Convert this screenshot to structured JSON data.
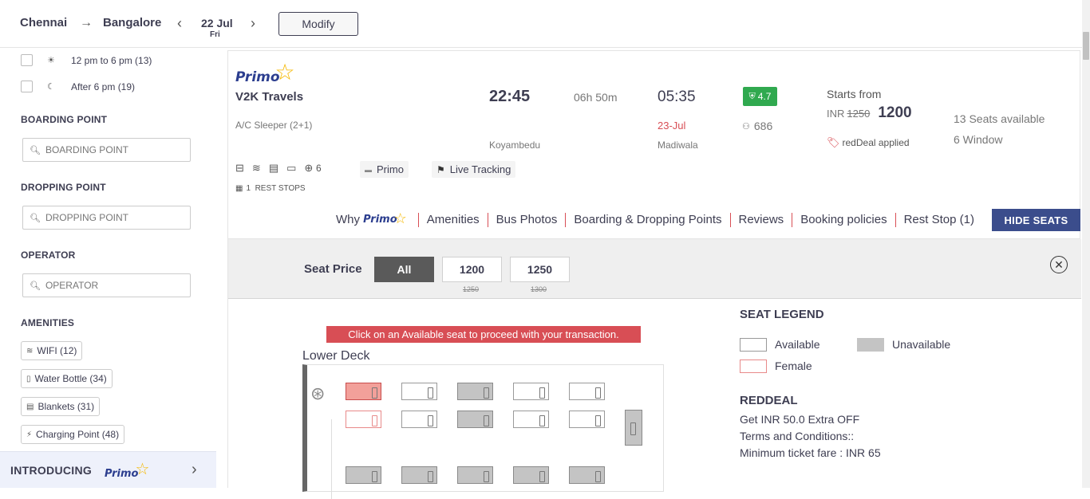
{
  "header": {
    "from_city": "Chennai",
    "to_city": "Bangalore",
    "date": "22 Jul",
    "day": "Fri",
    "modify_label": "Modify"
  },
  "sidebar": {
    "time_filters": [
      {
        "label": "12 pm to 6 pm (13)"
      },
      {
        "label": "After 6 pm (19)"
      }
    ],
    "boarding_title": "BOARDING POINT",
    "boarding_placeholder": "BOARDING POINT",
    "dropping_title": "DROPPING POINT",
    "dropping_placeholder": "DROPPING POINT",
    "operator_title": "OPERATOR",
    "operator_placeholder": "OPERATOR",
    "amenities_title": "AMENITIES",
    "amenities": [
      {
        "label": "WIFI (12)"
      },
      {
        "label": "Water Bottle (34)"
      },
      {
        "label": "Blankets (31)"
      },
      {
        "label": "Charging Point (48)"
      }
    ],
    "intro_label": "INTRODUCING",
    "primo_word": "Primo"
  },
  "bus": {
    "brand": "Primo",
    "name": "V2K Travels",
    "type": "A/C Sleeper (2+1)",
    "departure_time": "22:45",
    "duration": "06h 50m",
    "arrival_time": "05:35",
    "arrival_date": "23-Jul",
    "departure_point": "Koyambedu",
    "arrival_point": "Madiwala",
    "rating": "4.7",
    "rating_count": "686",
    "starts_from_label": "Starts from",
    "currency": "INR",
    "old_price": "1250",
    "price": "1200",
    "seats_available": "13 Seats available",
    "window_seats": "6 Window",
    "reddeal_label": "redDeal applied",
    "extra_amenities": "6",
    "primo_tag": "Primo",
    "live_tracking": "Live Tracking",
    "rest_stops_count": "1",
    "rest_stops_label": "REST STOPS"
  },
  "links": {
    "why_label": "Why",
    "why_brand": "Primo",
    "items": [
      "Amenities",
      "Bus Photos",
      "Boarding & Dropping Points",
      "Reviews",
      "Booking policies",
      "Rest Stop (1)"
    ],
    "hide_seats": "HIDE SEATS"
  },
  "seat_panel": {
    "seat_price_label": "Seat Price",
    "filters": [
      {
        "label": "All",
        "strike": ""
      },
      {
        "label": "1200",
        "strike": "1250"
      },
      {
        "label": "1250",
        "strike": "1300"
      }
    ],
    "notice": "Click on an Available seat to proceed with your transaction.",
    "deck_label": "Lower Deck",
    "legend_title": "SEAT LEGEND",
    "legend": {
      "available": "Available",
      "unavailable": "Unavailable",
      "female": "Female"
    },
    "reddeal_title": "REDDEAL",
    "reddeal_lines": [
      "Get INR 50.0 Extra OFF",
      "Terms and Conditions::",
      "Minimum ticket fare : INR 65"
    ]
  },
  "colors": {
    "brand_red": "#d84e55",
    "hide_button": "#3b4d8c",
    "rating_green": "#30a94f"
  }
}
